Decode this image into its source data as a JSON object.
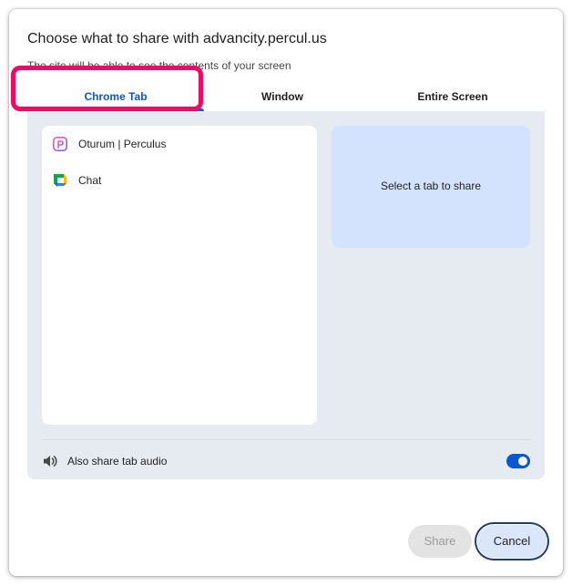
{
  "dialog": {
    "title": "Choose what to share with advancity.percul.us",
    "subtitle": "The site will be able to see the contents of your screen"
  },
  "tabs": [
    {
      "label": "Chrome Tab",
      "active": true
    },
    {
      "label": "Window",
      "active": false
    },
    {
      "label": "Entire Screen",
      "active": false
    }
  ],
  "tab_list": {
    "items": [
      {
        "label": "Oturum | Perculus",
        "icon": "perculus-icon"
      },
      {
        "label": "Chat",
        "icon": "google-chat-icon"
      }
    ]
  },
  "preview": {
    "text": "Select a tab to share"
  },
  "audio": {
    "label": "Also share tab audio",
    "enabled": true
  },
  "buttons": {
    "share": "Share",
    "cancel": "Cancel"
  },
  "colors": {
    "accent": "#0b57d0",
    "highlight": "#ed0c63",
    "panel_bg": "#e6eaf1",
    "preview_bg": "#d3e3fd"
  }
}
